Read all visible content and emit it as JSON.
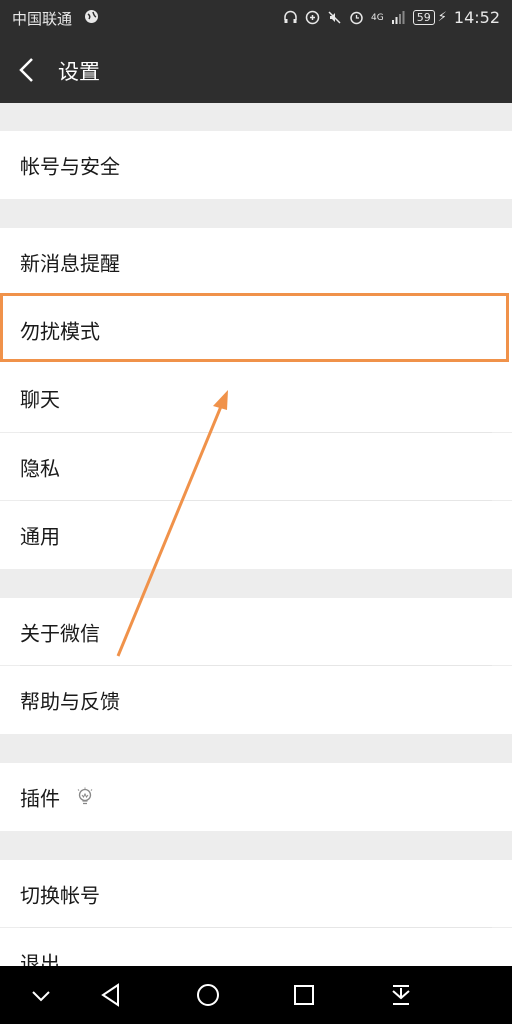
{
  "status_bar": {
    "carrier": "中国联通",
    "signal_label": "4G",
    "battery": "59",
    "time": "14:52"
  },
  "header": {
    "title": "设置",
    "back_icon": "chevron-left-icon"
  },
  "settings": {
    "account_security": "帐号与安全",
    "new_message_alerts": "新消息提醒",
    "do_not_disturb": "勿扰模式",
    "chat": "聊天",
    "privacy": "隐私",
    "general": "通用",
    "about": "关于微信",
    "help_feedback": "帮助与反馈",
    "plugins": "插件",
    "plugins_icon": "lightbulb-icon",
    "switch_account": "切换帐号",
    "logout": "退出"
  },
  "annotation": {
    "color": "#f0924a"
  },
  "nav_bar": {
    "icons": [
      "chevron-down-icon",
      "back-triangle-icon",
      "home-circle-icon",
      "recents-square-icon",
      "notification-pull-icon"
    ]
  }
}
